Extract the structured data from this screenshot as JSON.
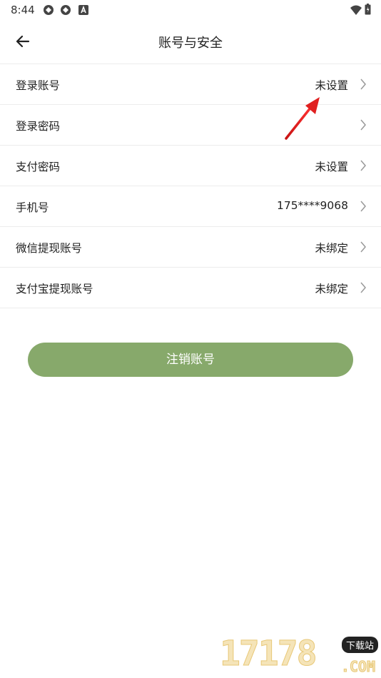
{
  "status_bar": {
    "time": "8:44",
    "icons": [
      "sync-icon",
      "sync-icon",
      "a-badge-icon"
    ],
    "right_icons": [
      "wifi-icon",
      "battery-charging-icon"
    ]
  },
  "header": {
    "title": "账号与安全",
    "back_icon": "arrow-left-icon"
  },
  "settings": {
    "items": [
      {
        "label": "登录账号",
        "value": "未设置"
      },
      {
        "label": "登录密码",
        "value": ""
      },
      {
        "label": "支付密码",
        "value": "未设置"
      },
      {
        "label": "手机号",
        "value": "175****9068"
      },
      {
        "label": "微信提现账号",
        "value": "未绑定"
      },
      {
        "label": "支付宝提现账号",
        "value": "未绑定"
      }
    ]
  },
  "actions": {
    "logout_label": "注销账号"
  },
  "watermark": {
    "number": "17178",
    "badge": "下载站",
    "domain": ".COM"
  },
  "colors": {
    "primary_button": "#87a96b",
    "annotation_arrow": "#e02020",
    "divider": "#ececec"
  }
}
